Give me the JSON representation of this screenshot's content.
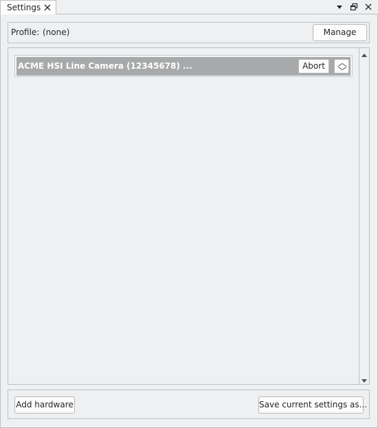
{
  "window": {
    "tab_title": "Settings",
    "icons": {
      "tab_close": "close-icon",
      "menu": "dropdown-arrow-icon",
      "float": "float-window-icon",
      "close": "close-icon"
    }
  },
  "profile": {
    "label": "Profile:",
    "value": "(none)",
    "manage_label": "Manage"
  },
  "devices": [
    {
      "name": "ACME HSI Line Camera (12345678) ...",
      "abort_label": "Abort",
      "collapse_icon": "collapse-toggle-icon"
    }
  ],
  "footer": {
    "add_label": "Add hardware",
    "save_label": "Save current settings as..."
  },
  "colors": {
    "device_header_bg": "#a8a9aa",
    "window_bg": "#eff0f1"
  }
}
